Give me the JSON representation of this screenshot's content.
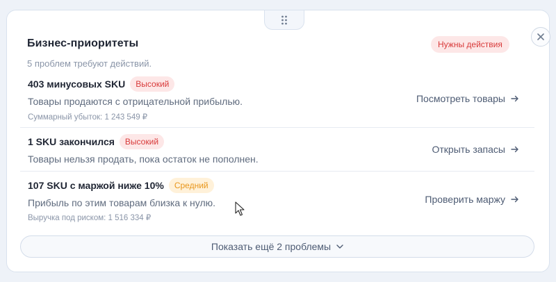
{
  "card": {
    "title": "Бизнес-приоритеты",
    "subtitle": "5 проблем требуют действий.",
    "status_badge": "Нужны действия"
  },
  "issues": [
    {
      "title": "403 минусовых SKU",
      "severity": "Высокий",
      "severity_level": "high",
      "description": "Товары продаются с отрицательной прибылью.",
      "meta": "Суммарный убыток: 1 243 549 ₽",
      "action": "Посмотреть товары"
    },
    {
      "title": "1 SKU закончился",
      "severity": "Высокий",
      "severity_level": "high",
      "description": "Товары нельзя продать, пока остаток не пополнен.",
      "meta": "",
      "action": "Открыть запасы"
    },
    {
      "title": "107 SKU с маржой ниже 10%",
      "severity": "Средний",
      "severity_level": "medium",
      "description": "Прибыль по этим товарам близка к нулю.",
      "meta": "Выручка под риском: 1 516 334 ₽",
      "action": "Проверить маржу"
    }
  ],
  "footer": {
    "show_more_label": "Показать ещё 2 проблемы"
  },
  "icons": {
    "drag": "drag-handle-icon",
    "close": "close-icon",
    "action_arrow": "arrow-right-icon",
    "expand": "chevron-down-icon",
    "cursor": "mouse-pointer-icon"
  },
  "colors": {
    "high_bg": "#fde7e7",
    "high_text": "#d83a3a",
    "medium_bg": "#fff1d9",
    "medium_text": "#e8961c",
    "accent_text": "#4d5b73"
  }
}
